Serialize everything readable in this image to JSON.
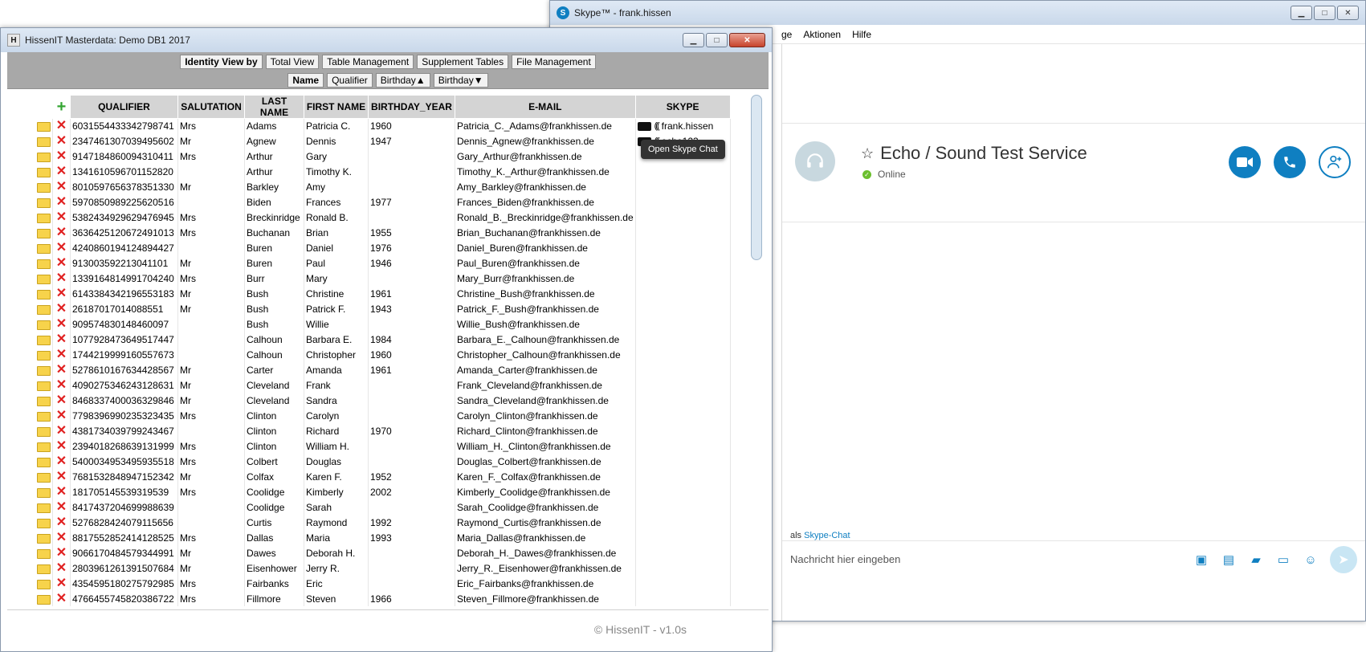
{
  "skype": {
    "title": "Skype™ - frank.hissen",
    "menu": [
      "ge",
      "Aktionen",
      "Hilfe"
    ],
    "contact": {
      "name": "Echo / Sound Test Service",
      "status": "Online"
    },
    "via_prefix": "als",
    "via_link": "Skype-Chat",
    "input_placeholder": "Nachricht hier eingeben",
    "accent_color": "#0f7fc1"
  },
  "masterdata": {
    "title": "HissenIT Masterdata: Demo DB1 2017",
    "nav_row1": [
      {
        "label": "Identity View by",
        "bold": true
      },
      {
        "label": "Total View"
      },
      {
        "label": "Table Management"
      },
      {
        "label": "Supplement Tables"
      },
      {
        "label": "File Management"
      }
    ],
    "nav_row2": [
      {
        "label": "Name",
        "bold": true
      },
      {
        "label": "Qualifier"
      },
      {
        "label": "Birthday▲"
      },
      {
        "label": "Birthday▼"
      }
    ],
    "tooltip": "Open Skype Chat",
    "columns": [
      "QUALIFIER",
      "SALUTATION",
      "LAST NAME",
      "FIRST NAME",
      "BIRTHDAY_YEAR",
      "E-MAIL",
      "SKYPE"
    ],
    "rows": [
      [
        "6031554433342798741",
        "Mrs",
        "Adams",
        "Patricia C.",
        "1960",
        "Patricia_C._Adams@frankhissen.de",
        "frank.hissen"
      ],
      [
        "2347461307039495602",
        "Mr",
        "Agnew",
        "Dennis",
        "1947",
        "Dennis_Agnew@frankhissen.de",
        "echo123"
      ],
      [
        "9147184860094310411",
        "Mrs",
        "Arthur",
        "Gary",
        "",
        "Gary_Arthur@frankhissen.de",
        ""
      ],
      [
        "1341610596701152820",
        "",
        "Arthur",
        "Timothy K.",
        "",
        "Timothy_K._Arthur@frankhissen.de",
        ""
      ],
      [
        "8010597656378351330",
        "Mr",
        "Barkley",
        "Amy",
        "",
        "Amy_Barkley@frankhissen.de",
        ""
      ],
      [
        "5970850989225620516",
        "",
        "Biden",
        "Frances",
        "1977",
        "Frances_Biden@frankhissen.de",
        ""
      ],
      [
        "5382434929629476945",
        "Mrs",
        "Breckinridge",
        "Ronald B.",
        "",
        "Ronald_B._Breckinridge@frankhissen.de",
        ""
      ],
      [
        "3636425120672491013",
        "Mrs",
        "Buchanan",
        "Brian",
        "1955",
        "Brian_Buchanan@frankhissen.de",
        ""
      ],
      [
        "4240860194124894427",
        "",
        "Buren",
        "Daniel",
        "1976",
        "Daniel_Buren@frankhissen.de",
        ""
      ],
      [
        "913003592213041101",
        "Mr",
        "Buren",
        "Paul",
        "1946",
        "Paul_Buren@frankhissen.de",
        ""
      ],
      [
        "1339164814991704240",
        "Mrs",
        "Burr",
        "Mary",
        "",
        "Mary_Burr@frankhissen.de",
        ""
      ],
      [
        "6143384342196553183",
        "Mr",
        "Bush",
        "Christine",
        "1961",
        "Christine_Bush@frankhissen.de",
        ""
      ],
      [
        "26187017014088551",
        "Mr",
        "Bush",
        "Patrick F.",
        "1943",
        "Patrick_F._Bush@frankhissen.de",
        ""
      ],
      [
        "909574830148460097",
        "",
        "Bush",
        "Willie",
        "",
        "Willie_Bush@frankhissen.de",
        ""
      ],
      [
        "1077928473649517447",
        "",
        "Calhoun",
        "Barbara E.",
        "1984",
        "Barbara_E._Calhoun@frankhissen.de",
        ""
      ],
      [
        "1744219999160557673",
        "",
        "Calhoun",
        "Christopher",
        "1960",
        "Christopher_Calhoun@frankhissen.de",
        ""
      ],
      [
        "5278610167634428567",
        "Mr",
        "Carter",
        "Amanda",
        "1961",
        "Amanda_Carter@frankhissen.de",
        ""
      ],
      [
        "4090275346243128631",
        "Mr",
        "Cleveland",
        "Frank",
        "",
        "Frank_Cleveland@frankhissen.de",
        ""
      ],
      [
        "8468337400036329846",
        "Mr",
        "Cleveland",
        "Sandra",
        "",
        "Sandra_Cleveland@frankhissen.de",
        ""
      ],
      [
        "7798396990235323435",
        "Mrs",
        "Clinton",
        "Carolyn",
        "",
        "Carolyn_Clinton@frankhissen.de",
        ""
      ],
      [
        "4381734039799243467",
        "",
        "Clinton",
        "Richard",
        "1970",
        "Richard_Clinton@frankhissen.de",
        ""
      ],
      [
        "2394018268639131999",
        "Mrs",
        "Clinton",
        "William H.",
        "",
        "William_H._Clinton@frankhissen.de",
        ""
      ],
      [
        "5400034953495935518",
        "Mrs",
        "Colbert",
        "Douglas",
        "",
        "Douglas_Colbert@frankhissen.de",
        ""
      ],
      [
        "7681532848947152342",
        "Mr",
        "Colfax",
        "Karen F.",
        "1952",
        "Karen_F._Colfax@frankhissen.de",
        ""
      ],
      [
        "181705145539319539",
        "Mrs",
        "Coolidge",
        "Kimberly",
        "2002",
        "Kimberly_Coolidge@frankhissen.de",
        ""
      ],
      [
        "8417437204699988639",
        "",
        "Coolidge",
        "Sarah",
        "",
        "Sarah_Coolidge@frankhissen.de",
        ""
      ],
      [
        "5276828424079115656",
        "",
        "Curtis",
        "Raymond",
        "1992",
        "Raymond_Curtis@frankhissen.de",
        ""
      ],
      [
        "8817552852414128525",
        "Mrs",
        "Dallas",
        "Maria",
        "1993",
        "Maria_Dallas@frankhissen.de",
        ""
      ],
      [
        "9066170484579344991",
        "Mr",
        "Dawes",
        "Deborah H.",
        "",
        "Deborah_H._Dawes@frankhissen.de",
        ""
      ],
      [
        "2803961261391507684",
        "Mr",
        "Eisenhower",
        "Jerry R.",
        "",
        "Jerry_R._Eisenhower@frankhissen.de",
        ""
      ],
      [
        "4354595180275792985",
        "Mrs",
        "Fairbanks",
        "Eric",
        "",
        "Eric_Fairbanks@frankhissen.de",
        ""
      ],
      [
        "4766455745820386722",
        "Mrs",
        "Fillmore",
        "Steven",
        "1966",
        "Steven_Fillmore@frankhissen.de",
        ""
      ]
    ],
    "footer": "© HissenIT - v1.0s"
  }
}
